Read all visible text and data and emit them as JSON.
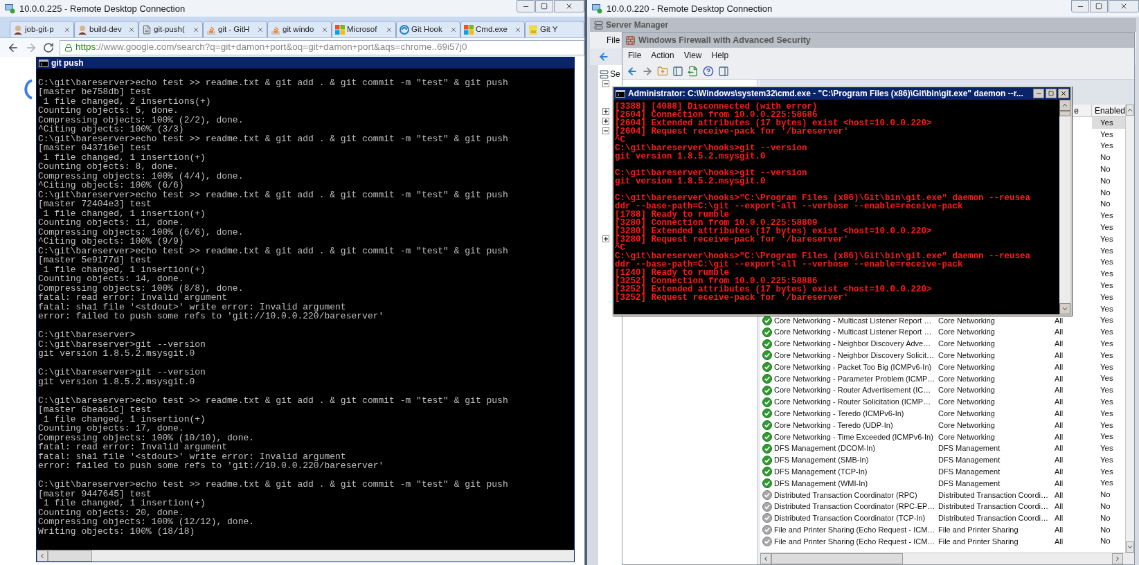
{
  "left_window": {
    "title": "10.0.0.225 - Remote Desktop Connection",
    "browser": {
      "tabs": [
        {
          "label": "job-git-p",
          "kind": "person",
          "selected": false,
          "closable": true
        },
        {
          "label": "build-dev",
          "kind": "person",
          "selected": false,
          "closable": true
        },
        {
          "label": "git-push(",
          "kind": "document",
          "selected": false,
          "closable": true
        },
        {
          "label": "git - GitH",
          "kind": "stack",
          "selected": false,
          "closable": true
        },
        {
          "label": "git windo",
          "kind": "stack",
          "selected": false,
          "closable": true
        },
        {
          "label": "Microsof",
          "kind": "windows",
          "selected": false,
          "closable": true
        },
        {
          "label": "Git Hook",
          "kind": "swirl",
          "selected": false,
          "closable": true
        },
        {
          "label": "Cmd.exe",
          "kind": "windows",
          "selected": false,
          "closable": true
        },
        {
          "label": "Git Y",
          "kind": "js",
          "selected": false,
          "closable": false
        }
      ],
      "address": {
        "scheme": "https",
        "rest": "://www.google.com/search?q=git+damon+port&oq=git+damon+port&aqs=chrome..69i57j0"
      }
    },
    "console": {
      "title": "git push",
      "blocks": [
        [
          "C:\\git\\bareserver>echo test >> readme.txt & git add . & git commit -m \"test\" & git push",
          "[master be758db] test",
          " 1 file changed, 2 insertions(+)",
          "Counting objects: 5, done.",
          "Compressing objects: 100% (2/2), done.",
          "^Citing objects: 100% (3/3)",
          "C:\\git\\bareserver>echo test >> readme.txt & git add . & git commit -m \"test\" & git push",
          "[master 043716e] test",
          " 1 file changed, 1 insertion(+)",
          "Counting objects: 8, done.",
          "Compressing objects: 100% (4/4), done.",
          "^Citing objects: 100% (6/6)",
          "C:\\git\\bareserver>echo test >> readme.txt & git add . & git commit -m \"test\" & git push",
          "[master 72404e3] test",
          " 1 file changed, 1 insertion(+)",
          "Counting objects: 11, done.",
          "Compressing objects: 100% (6/6), done.",
          "^Citing objects: 100% (9/9)",
          "C:\\git\\bareserver>echo test >> readme.txt & git add . & git commit -m \"test\" & git push",
          "[master 5e9177d] test",
          " 1 file changed, 1 insertion(+)",
          "Counting objects: 14, done.",
          "Compressing objects: 100% (8/8), done.",
          "fatal: read error: Invalid argument",
          "fatal: sha1 file '<stdout>' write error: Invalid argument",
          "error: failed to push some refs to 'git://10.0.0.220/bareserver'"
        ],
        [
          "C:\\git\\bareserver>",
          "C:\\git\\bareserver>git --version",
          "git version 1.8.5.2.msysgit.0"
        ],
        [
          "C:\\git\\bareserver>git --version",
          "git version 1.8.5.2.msysgit.0"
        ],
        [
          "C:\\git\\bareserver>echo test >> readme.txt & git add . & git commit -m \"test\" & git push",
          "[master 6bea61c] test",
          " 1 file changed, 1 insertion(+)",
          "Counting objects: 17, done.",
          "Compressing objects: 100% (10/10), done.",
          "fatal: read error: Invalid argument",
          "fatal: sha1 file '<stdout>' write error: Invalid argument",
          "error: failed to push some refs to 'git://10.0.0.220/bareserver'"
        ],
        [
          "C:\\git\\bareserver>echo test >> readme.txt & git add . & git commit -m \"test\" & git push",
          "[master 9447645] test",
          " 1 file changed, 1 insertion(+)",
          "Counting objects: 20, done.",
          "Compressing objects: 100% (12/12), done.",
          "Writing objects: 100% (18/18)"
        ]
      ]
    }
  },
  "right_window": {
    "title": "10.0.0.220 - Remote Desktop Connection",
    "server_manager": {
      "title": "Server Manager",
      "menu": [
        "File"
      ],
      "tree_label": "Se",
      "expanders": [
        {
          "expanded": true
        },
        {
          "expanded": false
        },
        {
          "expanded": false
        },
        {
          "expanded": true
        },
        {
          "expanded": false
        }
      ]
    },
    "firewall": {
      "title": "Windows Firewall with Advanced Security",
      "menu": [
        "File",
        "Action",
        "View",
        "Help"
      ],
      "columns": [
        {
          "label": "e"
        },
        {
          "label": "Enabled"
        }
      ],
      "hidden_rows": [
        {
          "enabled": "Yes",
          "selected": true
        },
        {
          "enabled": "Yes",
          "selected": false
        },
        {
          "enabled": "Yes",
          "selected": false
        },
        {
          "enabled": "No",
          "selected": false
        },
        {
          "enabled": "No",
          "selected": false
        },
        {
          "enabled": "No",
          "selected": false
        },
        {
          "enabled": "No",
          "selected": false
        },
        {
          "enabled": "No",
          "selected": false
        },
        {
          "enabled": "Yes",
          "selected": false
        },
        {
          "enabled": "Yes",
          "selected": false
        },
        {
          "enabled": "Yes",
          "selected": false
        },
        {
          "enabled": "Yes",
          "selected": false
        },
        {
          "enabled": "Yes",
          "selected": false
        },
        {
          "enabled": "Yes",
          "selected": false
        },
        {
          "enabled": "Yes",
          "selected": false
        },
        {
          "enabled": "Yes",
          "selected": false
        },
        {
          "enabled": "Yes",
          "selected": false
        }
      ],
      "rows": [
        {
          "name": "Core Networking - Multicast Listener Report …",
          "group": "Core Networking",
          "profile": "All",
          "enabled": "Yes",
          "active": true,
          "selected": false
        },
        {
          "name": "Core Networking - Multicast Listener Report …",
          "group": "Core Networking",
          "profile": "All",
          "enabled": "Yes",
          "active": true,
          "selected": false
        },
        {
          "name": "Core Networking - Neighbor Discovery Adve…",
          "group": "Core Networking",
          "profile": "All",
          "enabled": "Yes",
          "active": true,
          "selected": false
        },
        {
          "name": "Core Networking - Neighbor Discovery Solicit…",
          "group": "Core Networking",
          "profile": "All",
          "enabled": "Yes",
          "active": true,
          "selected": false
        },
        {
          "name": "Core Networking - Packet Too Big (ICMPv6-In)",
          "group": "Core Networking",
          "profile": "All",
          "enabled": "Yes",
          "active": true,
          "selected": false
        },
        {
          "name": "Core Networking - Parameter Problem (ICMP…",
          "group": "Core Networking",
          "profile": "All",
          "enabled": "Yes",
          "active": true,
          "selected": false
        },
        {
          "name": "Core Networking - Router Advertisement (IC…",
          "group": "Core Networking",
          "profile": "All",
          "enabled": "Yes",
          "active": true,
          "selected": false
        },
        {
          "name": "Core Networking - Router Solicitation (ICMP…",
          "group": "Core Networking",
          "profile": "All",
          "enabled": "Yes",
          "active": true,
          "selected": false
        },
        {
          "name": "Core Networking - Teredo (ICMPv6-In)",
          "group": "Core Networking",
          "profile": "All",
          "enabled": "Yes",
          "active": true,
          "selected": false
        },
        {
          "name": "Core Networking - Teredo (UDP-In)",
          "group": "Core Networking",
          "profile": "All",
          "enabled": "Yes",
          "active": true,
          "selected": false
        },
        {
          "name": "Core Networking - Time Exceeded (ICMPv6-In)",
          "group": "Core Networking",
          "profile": "All",
          "enabled": "Yes",
          "active": true,
          "selected": false
        },
        {
          "name": "DFS Management (DCOM-In)",
          "group": "DFS Management",
          "profile": "All",
          "enabled": "Yes",
          "active": true,
          "selected": false
        },
        {
          "name": "DFS Management (SMB-In)",
          "group": "DFS Management",
          "profile": "All",
          "enabled": "Yes",
          "active": true,
          "selected": false
        },
        {
          "name": "DFS Management (TCP-In)",
          "group": "DFS Management",
          "profile": "All",
          "enabled": "Yes",
          "active": true,
          "selected": false
        },
        {
          "name": "DFS Management (WMI-In)",
          "group": "DFS Management",
          "profile": "All",
          "enabled": "Yes",
          "active": true,
          "selected": false
        },
        {
          "name": "Distributed Transaction Coordinator (RPC)",
          "group": "Distributed Transaction Coordi…",
          "profile": "All",
          "enabled": "No",
          "active": false,
          "selected": false
        },
        {
          "name": "Distributed Transaction Coordinator (RPC-EP…",
          "group": "Distributed Transaction Coordi…",
          "profile": "All",
          "enabled": "No",
          "active": false,
          "selected": false
        },
        {
          "name": "Distributed Transaction Coordinator (TCP-In)",
          "group": "Distributed Transaction Coordi…",
          "profile": "All",
          "enabled": "No",
          "active": false,
          "selected": false
        },
        {
          "name": "File and Printer Sharing (Echo Request - ICM…",
          "group": "File and Printer Sharing",
          "profile": "All",
          "enabled": "No",
          "active": false,
          "selected": false
        },
        {
          "name": "File and Printer Sharing (Echo Request - ICM…",
          "group": "File and Printer Sharing",
          "profile": "All",
          "enabled": "No",
          "active": false,
          "selected": false
        }
      ]
    },
    "console": {
      "title": "Administrator: C:\\Windows\\system32\\cmd.exe - \"C:\\Program Files (x86)\\Git\\bin\\git.exe\"  daemon --r...",
      "blocks": [
        [
          "[3388] [4088] Disconnected (with error)",
          "[2604] Connection from 10.0.0.225:58686",
          "[2604] Extended attributes (17 bytes) exist <host=10.0.0.220>",
          "[2604] Request receive-pack for '/bareserver'",
          "^C",
          "C:\\git\\bareserver\\hooks>git --version",
          "git version 1.8.5.2.msysgit.0"
        ],
        [
          "C:\\git\\bareserver\\hooks>git --version",
          "git version 1.8.5.2.msysgit.0"
        ],
        [
          "C:\\git\\bareserver\\hooks>\"C:\\Program Files (x86)\\Git\\bin\\git.exe\" daemon --reusea",
          "ddr --base-path=C:\\git --export-all --verbose --enable=receive-pack",
          "[1788] Ready to rumble",
          "[3280] Connection from 10.0.0.225:58809",
          "[3280] Extended attributes (17 bytes) exist <host=10.0.0.220>",
          "[3280] Request receive-pack for '/bareserver'",
          "^C",
          "C:\\git\\bareserver\\hooks>\"C:\\Program Files (x86)\\Git\\bin\\git.exe\" daemon --reusea",
          "ddr --base-path=C:\\git --export-all --verbose --enable=receive-pack",
          "[1240] Ready to rumble",
          "[3252] Connection from 10.0.0.225:58886",
          "[3252] Extended attributes (17 bytes) exist <host=10.0.0.220>",
          "[3252] Request receive-pack for '/bareserver'"
        ]
      ]
    }
  }
}
